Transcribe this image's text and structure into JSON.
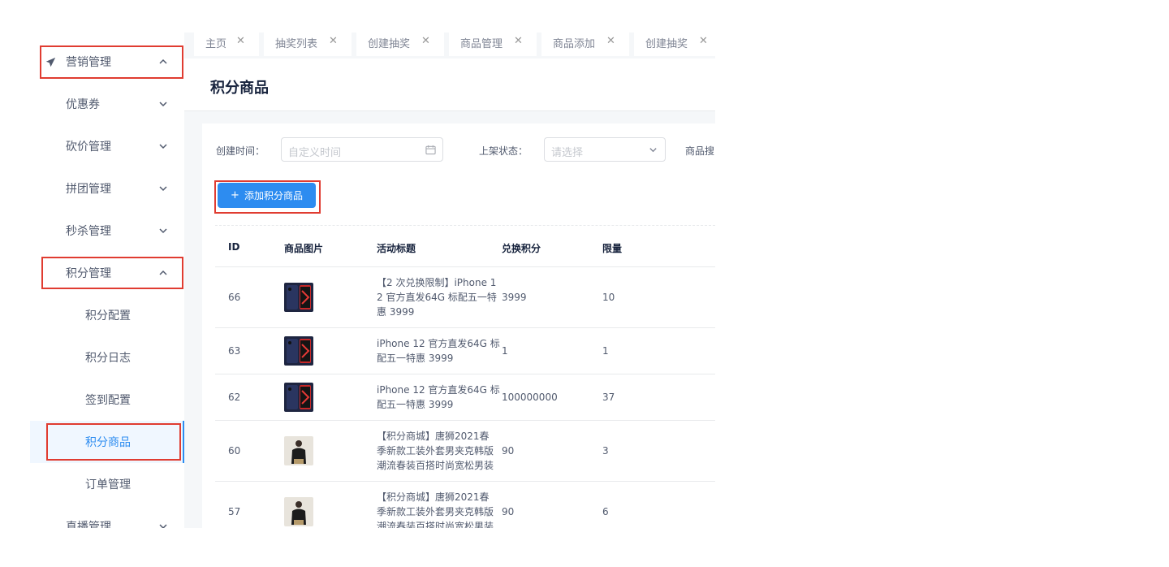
{
  "sidebar": {
    "marketing": "营销管理",
    "coupon": "优惠券",
    "bargain": "砍价管理",
    "group_buy": "拼团管理",
    "flash_sale": "秒杀管理",
    "points": "积分管理",
    "points_config": "积分配置",
    "points_log": "积分日志",
    "checkin_config": "签到配置",
    "points_goods": "积分商品",
    "order_mgmt": "订单管理",
    "live": "直播管理"
  },
  "tabs": [
    {
      "label": "主页"
    },
    {
      "label": "抽奖列表"
    },
    {
      "label": "创建抽奖"
    },
    {
      "label": "商品管理"
    },
    {
      "label": "商品添加"
    },
    {
      "label": "创建抽奖"
    }
  ],
  "page": {
    "title": "积分商品"
  },
  "filters": {
    "created_time_label": "创建时间：",
    "created_time_placeholder": "自定义时间",
    "status_label": "上架状态：",
    "status_placeholder": "请选择",
    "search_label": "商品搜"
  },
  "actions": {
    "add_label": "添加积分商品"
  },
  "table": {
    "headers": {
      "id": "ID",
      "image": "商品图片",
      "title": "活动标题",
      "points": "兑换积分",
      "limit": "限量"
    },
    "rows": [
      {
        "id": "66",
        "title_lines": [
          "【2 次兑换限制】iPhone 1",
          "2 官方直发64G 标配五一特",
          "惠 3999"
        ],
        "points": "3999",
        "limit": "10",
        "thumb": "phone"
      },
      {
        "id": "63",
        "title_lines": [
          "iPhone 12 官方直发64G 标",
          "配五一特惠 3999"
        ],
        "points": "1",
        "limit": "1",
        "thumb": "phone"
      },
      {
        "id": "62",
        "title_lines": [
          "iPhone 12 官方直发64G 标",
          "配五一特惠 3999"
        ],
        "points": "100000000",
        "limit": "37",
        "thumb": "phone"
      },
      {
        "id": "60",
        "title_lines": [
          "【积分商城】唐狮2021春",
          "季新款工装外套男夹克韩版",
          "潮流春装百搭时尚宽松男装"
        ],
        "points": "90",
        "limit": "3",
        "thumb": "jacket"
      },
      {
        "id": "57",
        "title_lines": [
          "【积分商城】唐狮2021春",
          "季新款工装外套男夹克韩版",
          "潮流春装百搭时尚宽松男装"
        ],
        "points": "90",
        "limit": "6",
        "thumb": "jacket"
      }
    ]
  },
  "colors": {
    "accent": "#2d8cf0",
    "highlight": "#e03c31"
  }
}
